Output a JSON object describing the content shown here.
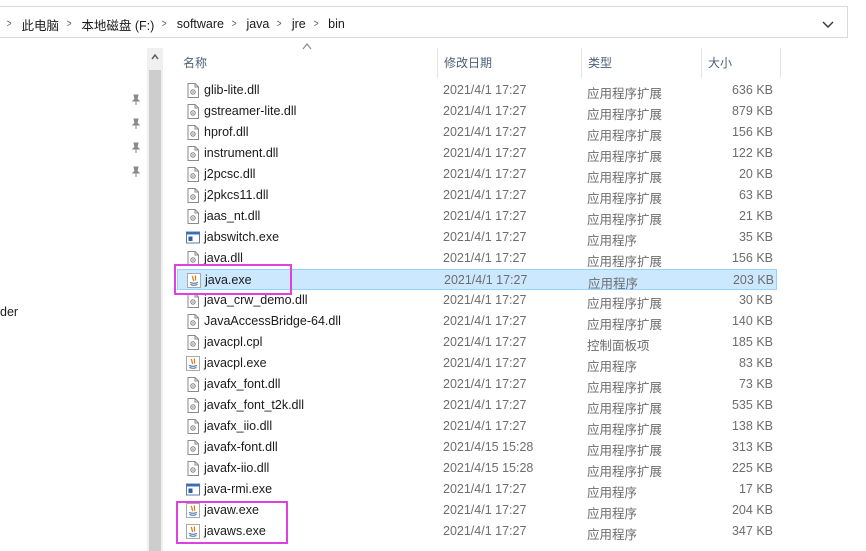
{
  "address_bar": {
    "breadcrumbs": [
      "此电脑",
      "本地磁盘 (F:)",
      "software",
      "java",
      "jre",
      "bin"
    ],
    "separator": ">"
  },
  "nav": {
    "partial_label": "der"
  },
  "columns": {
    "name": "名称",
    "date": "修改日期",
    "type": "类型",
    "size": "大小"
  },
  "files": [
    {
      "name": "glib-lite.dll",
      "date": "2021/4/1 17:27",
      "type": "应用程序扩展",
      "size": "636 KB",
      "icon": "dll-icon"
    },
    {
      "name": "gstreamer-lite.dll",
      "date": "2021/4/1 17:27",
      "type": "应用程序扩展",
      "size": "879 KB",
      "icon": "dll-icon"
    },
    {
      "name": "hprof.dll",
      "date": "2021/4/1 17:27",
      "type": "应用程序扩展",
      "size": "156 KB",
      "icon": "dll-icon"
    },
    {
      "name": "instrument.dll",
      "date": "2021/4/1 17:27",
      "type": "应用程序扩展",
      "size": "122 KB",
      "icon": "dll-icon"
    },
    {
      "name": "j2pcsc.dll",
      "date": "2021/4/1 17:27",
      "type": "应用程序扩展",
      "size": "20 KB",
      "icon": "dll-icon"
    },
    {
      "name": "j2pkcs11.dll",
      "date": "2021/4/1 17:27",
      "type": "应用程序扩展",
      "size": "63 KB",
      "icon": "dll-icon"
    },
    {
      "name": "jaas_nt.dll",
      "date": "2021/4/1 17:27",
      "type": "应用程序扩展",
      "size": "21 KB",
      "icon": "dll-icon"
    },
    {
      "name": "jabswitch.exe",
      "date": "2021/4/1 17:27",
      "type": "应用程序",
      "size": "35 KB",
      "icon": "window-exe-icon"
    },
    {
      "name": "java.dll",
      "date": "2021/4/1 17:27",
      "type": "应用程序扩展",
      "size": "156 KB",
      "icon": "dll-icon"
    },
    {
      "name": "java.exe",
      "date": "2021/4/1 17:27",
      "type": "应用程序",
      "size": "203 KB",
      "icon": "java-exe-icon",
      "selected": true
    },
    {
      "name": "java_crw_demo.dll",
      "date": "2021/4/1 17:27",
      "type": "应用程序扩展",
      "size": "30 KB",
      "icon": "dll-icon"
    },
    {
      "name": "JavaAccessBridge-64.dll",
      "date": "2021/4/1 17:27",
      "type": "应用程序扩展",
      "size": "140 KB",
      "icon": "dll-icon"
    },
    {
      "name": "javacpl.cpl",
      "date": "2021/4/1 17:27",
      "type": "控制面板项",
      "size": "185 KB",
      "icon": "dll-icon"
    },
    {
      "name": "javacpl.exe",
      "date": "2021/4/1 17:27",
      "type": "应用程序",
      "size": "83 KB",
      "icon": "java-exe-icon"
    },
    {
      "name": "javafx_font.dll",
      "date": "2021/4/1 17:27",
      "type": "应用程序扩展",
      "size": "73 KB",
      "icon": "dll-icon"
    },
    {
      "name": "javafx_font_t2k.dll",
      "date": "2021/4/1 17:27",
      "type": "应用程序扩展",
      "size": "535 KB",
      "icon": "dll-icon"
    },
    {
      "name": "javafx_iio.dll",
      "date": "2021/4/1 17:27",
      "type": "应用程序扩展",
      "size": "138 KB",
      "icon": "dll-icon"
    },
    {
      "name": "javafx-font.dll",
      "date": "2021/4/15 15:28",
      "type": "应用程序扩展",
      "size": "313 KB",
      "icon": "dll-icon"
    },
    {
      "name": "javafx-iio.dll",
      "date": "2021/4/15 15:28",
      "type": "应用程序扩展",
      "size": "225 KB",
      "icon": "dll-icon"
    },
    {
      "name": "java-rmi.exe",
      "date": "2021/4/1 17:27",
      "type": "应用程序",
      "size": "17 KB",
      "icon": "window-exe-icon"
    },
    {
      "name": "javaw.exe",
      "date": "2021/4/1 17:27",
      "type": "应用程序",
      "size": "204 KB",
      "icon": "java-exe-icon"
    },
    {
      "name": "javaws.exe",
      "date": "2021/4/1 17:27",
      "type": "应用程序",
      "size": "347 KB",
      "icon": "java-exe-icon"
    }
  ],
  "colors": {
    "selection_bg": "#cce8ff",
    "selection_border": "#99d1ff",
    "highlight_box": "#e040e0",
    "header_text": "#4c607a"
  }
}
